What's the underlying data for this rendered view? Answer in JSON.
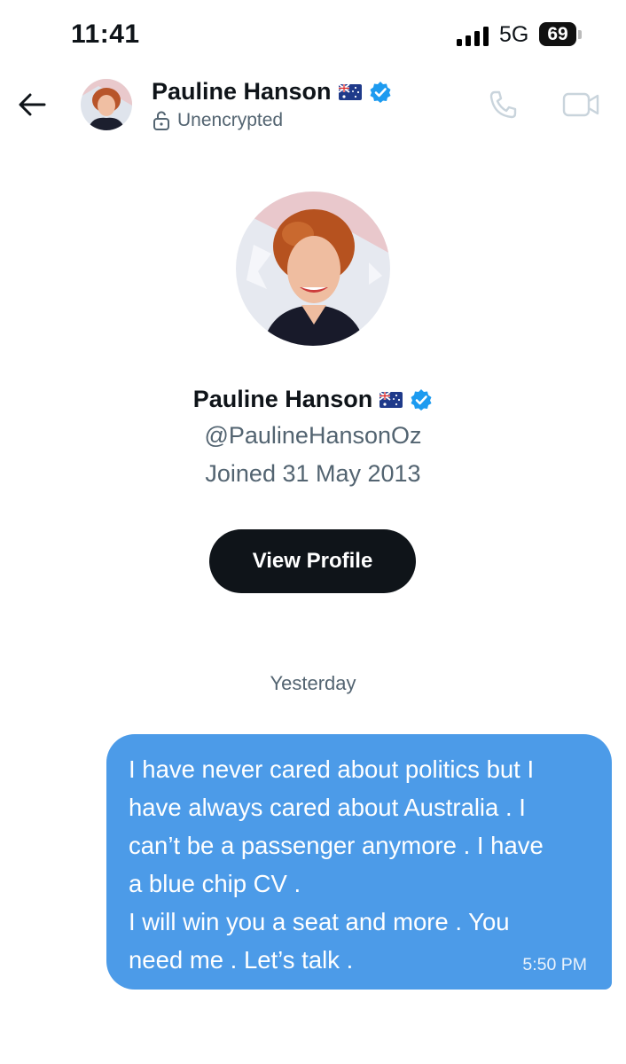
{
  "status_bar": {
    "time": "11:41",
    "network": "5G",
    "battery": "69"
  },
  "header": {
    "name": "Pauline Hanson",
    "encryption": "Unencrypted"
  },
  "profile": {
    "name": "Pauline Hanson",
    "handle": "@PaulineHansonOz",
    "joined": "Joined 31 May 2013",
    "view_profile_label": "View Profile"
  },
  "conversation": {
    "day_label": "Yesterday",
    "messages": [
      {
        "text": "I have never cared about politics but I\nhave always cared about Australia . I\ncan’t be a passenger anymore . I have\na blue chip CV .\nI will win you a seat and more . You\nneed me . Let’s talk .",
        "time": "5:50 PM"
      }
    ]
  },
  "colors": {
    "bubble": "#4c9be8",
    "button": "#0f1419",
    "verified": "#1d9bf0",
    "muted": "#536471"
  },
  "icons": [
    "signal-icon",
    "battery-icon",
    "back-arrow-icon",
    "lock-open-icon",
    "verified-badge-icon",
    "australia-flag-icon",
    "phone-icon",
    "video-icon"
  ]
}
